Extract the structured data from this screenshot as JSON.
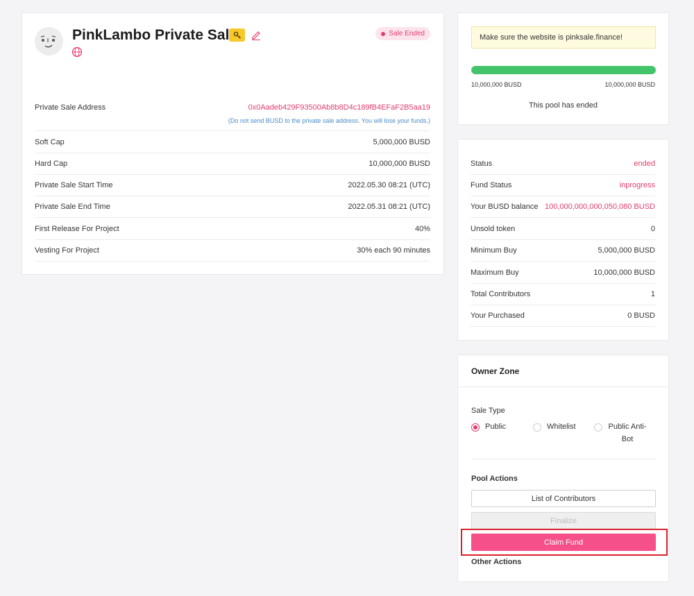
{
  "project": {
    "title": "PinkLambo Private Sale",
    "status": "Sale Ended"
  },
  "details": [
    {
      "label": "Private Sale Address",
      "value": "0x0Aadeb429F93500Ab8b8D4c189fB4EFaF2B5aa19"
    },
    {
      "label": "Soft Cap",
      "value": "5,000,000 BUSD"
    },
    {
      "label": "Hard Cap",
      "value": "10,000,000 BUSD"
    },
    {
      "label": "Private Sale Start Time",
      "value": "2022.05.30 08:21 (UTC)"
    },
    {
      "label": "Private Sale End Time",
      "value": "2022.05.31 08:21 (UTC)"
    },
    {
      "label": "First Release For Project",
      "value": "40%"
    },
    {
      "label": "Vesting For Project",
      "value": "30% each 90 minutes"
    }
  ],
  "address_warning": "(Do not send BUSD to the private sale address. You will lose your funds.)",
  "info": {
    "notice": "Make sure the website is pinksale.finance!",
    "progress_fraction": 1.0,
    "progress_left": "10,000,000 BUSD",
    "progress_right": "10,000,000 BUSD",
    "pool_status_text": "This pool has ended"
  },
  "stats": [
    {
      "label": "Status",
      "value": "ended"
    },
    {
      "label": "Fund Status",
      "value": "inprogress"
    },
    {
      "label": "Your BUSD balance",
      "value": "100,000,000,000,050,080 BUSD"
    },
    {
      "label": "Unsold token",
      "value": "0"
    },
    {
      "label": "Minimum Buy",
      "value": "5,000,000 BUSD"
    },
    {
      "label": "Maximum Buy",
      "value": "10,000,000 BUSD"
    },
    {
      "label": "Total Contributors",
      "value": "1"
    },
    {
      "label": "Your Purchased",
      "value": "0 BUSD"
    }
  ],
  "owner": {
    "title": "Owner Zone",
    "sale_type_label": "Sale Type",
    "sale_types": [
      "Public",
      "Whitelist",
      "Public Anti-Bot"
    ],
    "selected_sale_type": "Public",
    "pool_actions_label": "Pool Actions",
    "list_contributors_label": "List of Contributors",
    "finalize_label": "Finalize",
    "claim_fund_label": "Claim Fund",
    "other_actions_label": "Other Actions"
  },
  "colors": {
    "accent": "#e23c6d",
    "primary_button": "#f5508a",
    "progress": "#44c46a",
    "highlight": "#d8202c"
  }
}
